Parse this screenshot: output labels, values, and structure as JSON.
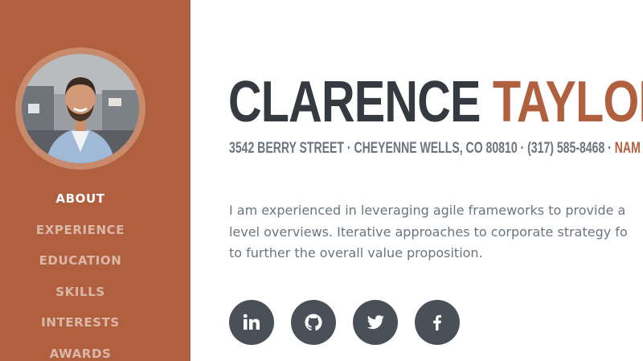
{
  "profile": {
    "first_name": "CLARENCE",
    "last_name": "TAYLOR",
    "address": "3542 BERRY STREET · CHEYENNE WELLS, CO 80810 · (317) 585-8468 ·",
    "email_fragment": "NAM",
    "bio_lines": [
      "I am experienced in leveraging agile frameworks to provide a",
      "level overviews. Iterative approaches to corporate strategy fo",
      "to further the overall value proposition."
    ]
  },
  "nav": {
    "items": [
      {
        "label": "ABOUT",
        "active": true
      },
      {
        "label": "EXPERIENCE",
        "active": false
      },
      {
        "label": "EDUCATION",
        "active": false
      },
      {
        "label": "SKILLS",
        "active": false
      },
      {
        "label": "INTERESTS",
        "active": false
      },
      {
        "label": "AWARDS",
        "active": false
      }
    ]
  },
  "social": [
    {
      "icon": "linkedin-icon"
    },
    {
      "icon": "github-icon"
    },
    {
      "icon": "twitter-icon"
    },
    {
      "icon": "facebook-icon"
    }
  ],
  "colors": {
    "primary": "#b0603f",
    "heading": "#343a40",
    "muted": "#6c757d",
    "social_bg": "#495057"
  }
}
